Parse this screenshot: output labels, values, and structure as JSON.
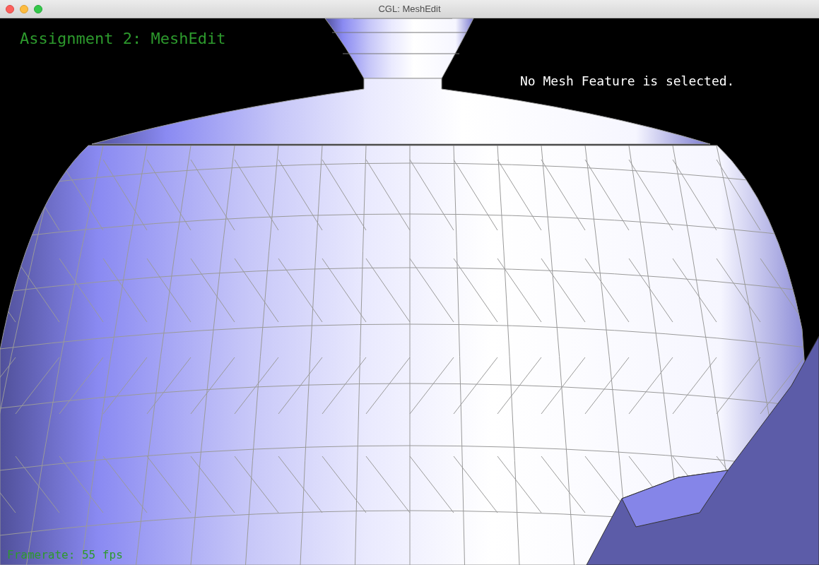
{
  "window": {
    "title": "CGL: MeshEdit"
  },
  "overlay": {
    "heading": "Assignment 2: MeshEdit",
    "status": "No Mesh Feature is selected.",
    "framerate": "Framerate: 55 fps"
  }
}
